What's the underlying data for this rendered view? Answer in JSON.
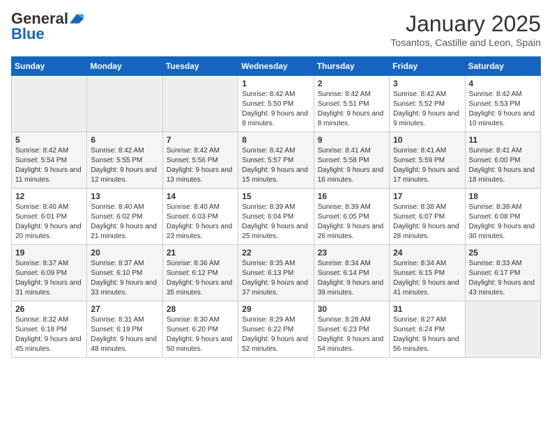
{
  "logo": {
    "general": "General",
    "blue": "Blue"
  },
  "header": {
    "month_year": "January 2025",
    "location": "Tosantos, Castille and Leon, Spain"
  },
  "weekdays": [
    "Sunday",
    "Monday",
    "Tuesday",
    "Wednesday",
    "Thursday",
    "Friday",
    "Saturday"
  ],
  "weeks": [
    [
      {
        "day": "",
        "info": ""
      },
      {
        "day": "",
        "info": ""
      },
      {
        "day": "",
        "info": ""
      },
      {
        "day": "1",
        "info": "Sunrise: 8:42 AM\nSunset: 5:50 PM\nDaylight: 9 hours and 8 minutes."
      },
      {
        "day": "2",
        "info": "Sunrise: 8:42 AM\nSunset: 5:51 PM\nDaylight: 9 hours and 8 minutes."
      },
      {
        "day": "3",
        "info": "Sunrise: 8:42 AM\nSunset: 5:52 PM\nDaylight: 9 hours and 9 minutes."
      },
      {
        "day": "4",
        "info": "Sunrise: 8:42 AM\nSunset: 5:53 PM\nDaylight: 9 hours and 10 minutes."
      }
    ],
    [
      {
        "day": "5",
        "info": "Sunrise: 8:42 AM\nSunset: 5:54 PM\nDaylight: 9 hours and 11 minutes."
      },
      {
        "day": "6",
        "info": "Sunrise: 8:42 AM\nSunset: 5:55 PM\nDaylight: 9 hours and 12 minutes."
      },
      {
        "day": "7",
        "info": "Sunrise: 8:42 AM\nSunset: 5:56 PM\nDaylight: 9 hours and 13 minutes."
      },
      {
        "day": "8",
        "info": "Sunrise: 8:42 AM\nSunset: 5:57 PM\nDaylight: 9 hours and 15 minutes."
      },
      {
        "day": "9",
        "info": "Sunrise: 8:41 AM\nSunset: 5:58 PM\nDaylight: 9 hours and 16 minutes."
      },
      {
        "day": "10",
        "info": "Sunrise: 8:41 AM\nSunset: 5:59 PM\nDaylight: 9 hours and 17 minutes."
      },
      {
        "day": "11",
        "info": "Sunrise: 8:41 AM\nSunset: 6:00 PM\nDaylight: 9 hours and 18 minutes."
      }
    ],
    [
      {
        "day": "12",
        "info": "Sunrise: 8:40 AM\nSunset: 6:01 PM\nDaylight: 9 hours and 20 minutes."
      },
      {
        "day": "13",
        "info": "Sunrise: 8:40 AM\nSunset: 6:02 PM\nDaylight: 9 hours and 21 minutes."
      },
      {
        "day": "14",
        "info": "Sunrise: 8:40 AM\nSunset: 6:03 PM\nDaylight: 9 hours and 23 minutes."
      },
      {
        "day": "15",
        "info": "Sunrise: 8:39 AM\nSunset: 6:04 PM\nDaylight: 9 hours and 25 minutes."
      },
      {
        "day": "16",
        "info": "Sunrise: 8:39 AM\nSunset: 6:05 PM\nDaylight: 9 hours and 26 minutes."
      },
      {
        "day": "17",
        "info": "Sunrise: 8:38 AM\nSunset: 6:07 PM\nDaylight: 9 hours and 28 minutes."
      },
      {
        "day": "18",
        "info": "Sunrise: 8:38 AM\nSunset: 6:08 PM\nDaylight: 9 hours and 30 minutes."
      }
    ],
    [
      {
        "day": "19",
        "info": "Sunrise: 8:37 AM\nSunset: 6:09 PM\nDaylight: 9 hours and 31 minutes."
      },
      {
        "day": "20",
        "info": "Sunrise: 8:37 AM\nSunset: 6:10 PM\nDaylight: 9 hours and 33 minutes."
      },
      {
        "day": "21",
        "info": "Sunrise: 8:36 AM\nSunset: 6:12 PM\nDaylight: 9 hours and 35 minutes."
      },
      {
        "day": "22",
        "info": "Sunrise: 8:35 AM\nSunset: 6:13 PM\nDaylight: 9 hours and 37 minutes."
      },
      {
        "day": "23",
        "info": "Sunrise: 8:34 AM\nSunset: 6:14 PM\nDaylight: 9 hours and 39 minutes."
      },
      {
        "day": "24",
        "info": "Sunrise: 8:34 AM\nSunset: 6:15 PM\nDaylight: 9 hours and 41 minutes."
      },
      {
        "day": "25",
        "info": "Sunrise: 8:33 AM\nSunset: 6:17 PM\nDaylight: 9 hours and 43 minutes."
      }
    ],
    [
      {
        "day": "26",
        "info": "Sunrise: 8:32 AM\nSunset: 6:18 PM\nDaylight: 9 hours and 45 minutes."
      },
      {
        "day": "27",
        "info": "Sunrise: 8:31 AM\nSunset: 6:19 PM\nDaylight: 9 hours and 48 minutes."
      },
      {
        "day": "28",
        "info": "Sunrise: 8:30 AM\nSunset: 6:20 PM\nDaylight: 9 hours and 50 minutes."
      },
      {
        "day": "29",
        "info": "Sunrise: 8:29 AM\nSunset: 6:22 PM\nDaylight: 9 hours and 52 minutes."
      },
      {
        "day": "30",
        "info": "Sunrise: 8:28 AM\nSunset: 6:23 PM\nDaylight: 9 hours and 54 minutes."
      },
      {
        "day": "31",
        "info": "Sunrise: 8:27 AM\nSunset: 6:24 PM\nDaylight: 9 hours and 56 minutes."
      },
      {
        "day": "",
        "info": ""
      }
    ]
  ]
}
